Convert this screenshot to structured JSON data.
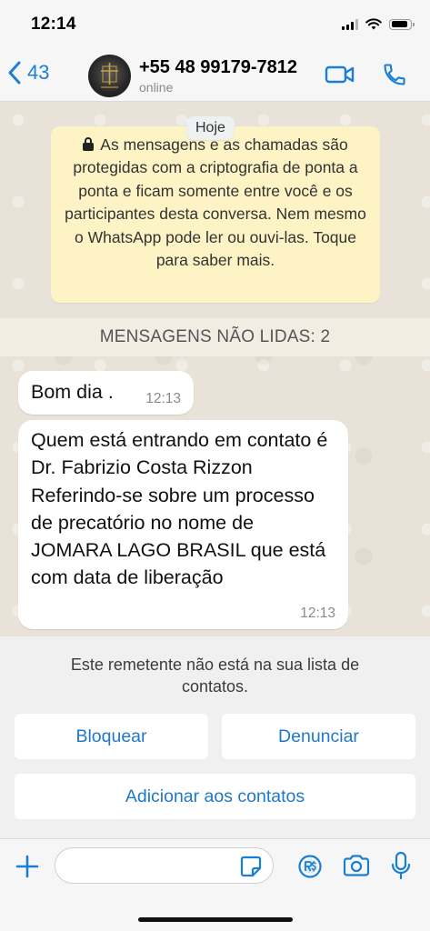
{
  "status_bar": {
    "time": "12:14"
  },
  "header": {
    "back_count": "43",
    "contact_name": "+55 48 99179-7812",
    "contact_status": "online"
  },
  "chat": {
    "day_label": "Hoje",
    "encryption_notice": "As mensagens e as chamadas são protegidas com a criptografia de ponta a ponta e ficam somente entre você e os participantes desta conversa. Nem mesmo o WhatsApp pode ler ou ouvi-las. Toque para saber mais.",
    "unread_banner": "MENSAGENS NÃO LIDAS: 2",
    "messages": [
      {
        "text": "Bom dia .",
        "time": "12:13"
      },
      {
        "text": "Quem está entrando em contato é Dr. Fabrizio Costa Rizzon Referindo-se sobre um processo de precatório no nome de JOMARA LAGO BRASIL que está com data de liberação",
        "time": "12:13"
      }
    ]
  },
  "unknown_sender": {
    "message": "Este remetente não está na sua lista de contatos.",
    "block_label": "Bloquear",
    "report_label": "Denunciar",
    "add_label": "Adicionar aos contatos"
  },
  "composer": {
    "input_value": ""
  },
  "colors": {
    "accent": "#1a7fd4",
    "chat_background": "#e8e2d8",
    "encryption_notice_bg": "#fdf3c4",
    "unread_banner_bg": "#f3ece3"
  }
}
